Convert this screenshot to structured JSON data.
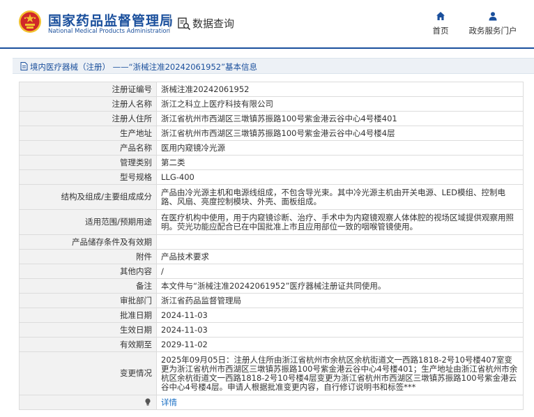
{
  "header": {
    "site_title_cn": "国家药品监督管理局",
    "site_title_en": "National Medical Products Administration",
    "section_label": "数据查询",
    "nav": {
      "home_label": "首页",
      "portal_label": "政务服务门户"
    }
  },
  "breadcrumb": {
    "text": "境内医疗器械（注册） ——“浙械注准20242061952”基本信息"
  },
  "colors": {
    "brand_blue": "#1a4f9c",
    "link_blue": "#1a6fc4",
    "logo_red": "#d02828",
    "logo_gold": "#f2c230"
  },
  "icons": {
    "logo": "nmpa-emblem-icon",
    "section": "document-search-icon",
    "home": "home-icon",
    "portal": "user-icon",
    "breadcrumb": "document-icon",
    "detail": "bulb-icon"
  },
  "rows": [
    {
      "label": "注册证编号",
      "value": "浙械注准20242061952"
    },
    {
      "label": "注册人名称",
      "value": "浙江之科立上医疗科技有限公司"
    },
    {
      "label": "注册人住所",
      "value": "浙江省杭州市西湖区三墩镇苏振路100号紫金港云谷中心4号楼401"
    },
    {
      "label": "生产地址",
      "value": "浙江省杭州市西湖区三墩镇苏振路100号紫金港云谷中心4号楼4层"
    },
    {
      "label": "产品名称",
      "value": "医用内窥镜冷光源"
    },
    {
      "label": "管理类别",
      "value": "第二类"
    },
    {
      "label": "型号规格",
      "value": "LLG-400"
    },
    {
      "label": "结构及组成/主要组成成分",
      "value": "产品由冷光源主机和电源线组成，不包含导光束。其中冷光源主机由开关电源、LED模组、控制电路、风扇、亮度控制模块、外壳、面板组成。"
    },
    {
      "label": "适用范围/预期用途",
      "value": "在医疗机构中使用，用于内窥镜诊断、治疗、手术中为内窥镜观察人体体腔的视场区域提供观察用照明。荧光功能应配合已在中国批准上市且应用部位一致的咽喉管镜使用。"
    },
    {
      "label": "产品储存条件及有效期",
      "value": ""
    },
    {
      "label": "附件",
      "value": "产品技术要求"
    },
    {
      "label": "其他内容",
      "value": "/"
    },
    {
      "label": "备注",
      "value": "本文件与“浙械注准20242061952”医疗器械注册证共同使用。"
    },
    {
      "label": "审批部门",
      "value": "浙江省药品监督管理局"
    },
    {
      "label": "批准日期",
      "value": "2024-11-03"
    },
    {
      "label": "生效日期",
      "value": "2024-11-03"
    },
    {
      "label": "有效期至",
      "value": "2029-11-02"
    },
    {
      "label": "变更情况",
      "value": "2025年09月05日：注册人住所由浙江省杭州市余杭区余杭街道文一西路1818-2号10号楼407室变更为浙江省杭州市西湖区三墩镇苏振路100号紫金港云谷中心4号楼401；生产地址由浙江省杭州市余杭区余杭街道文一西路1818-2号10号楼4层变更为浙江省杭州市西湖区三墩镇苏振路100号紫金港云谷中心4号楼4层。申请人根据批准变更内容，自行修订说明书和标签***"
    }
  ],
  "detail_link": {
    "label": "详情"
  }
}
